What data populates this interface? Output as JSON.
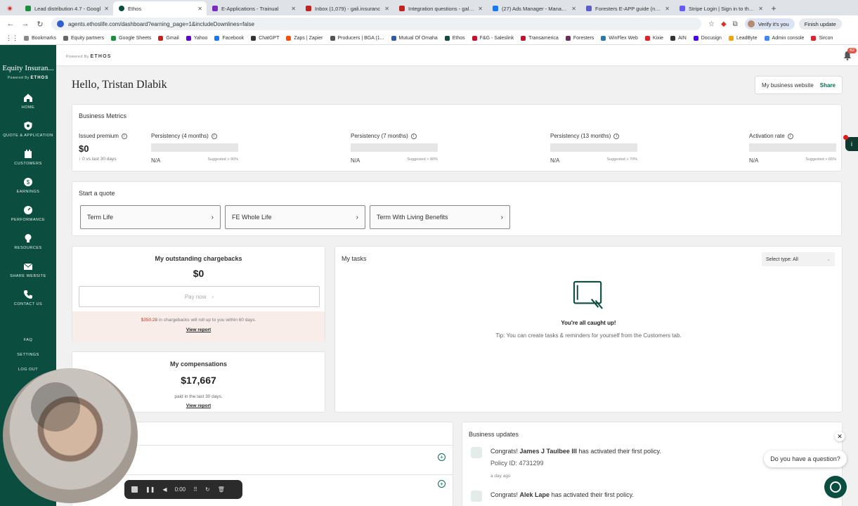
{
  "browser": {
    "tabs": [
      {
        "title": "Lead distribution 4.7 - Googl",
        "color": "#1e8e3e"
      },
      {
        "title": "Ethos",
        "color": "#0b4d3e",
        "active": true
      },
      {
        "title": "E-Applications - Trainual",
        "color": "#7b2cbf"
      },
      {
        "title": "Inbox (1,079) - gali.insuranc",
        "color": "#c5221f"
      },
      {
        "title": "Integration questions - gali@",
        "color": "#c5221f"
      },
      {
        "title": "(27) Ads Manager - Manage a",
        "color": "#1877f2"
      },
      {
        "title": "Foresters E-APP guide (non n",
        "color": "#5b5fc7"
      },
      {
        "title": "Stripe Login | Sign in to the S",
        "color": "#635bff"
      }
    ],
    "url": "agents.ethoslife.com/dashboard?earning_page=1&includeDownlines=false",
    "verify_label": "Verify it's you",
    "finish_label": "Finish update",
    "bookmarks": [
      {
        "label": "Bookmarks",
        "color": "#888"
      },
      {
        "label": "Equity partners",
        "color": "#666"
      },
      {
        "label": "Google Sheets",
        "color": "#1e8e3e"
      },
      {
        "label": "Gmail",
        "color": "#c5221f"
      },
      {
        "label": "Yahoo",
        "color": "#6001d2"
      },
      {
        "label": "Facebook",
        "color": "#1877f2"
      },
      {
        "label": "ChatGPT",
        "color": "#333"
      },
      {
        "label": "Zaps | Zapier",
        "color": "#ff4f00"
      },
      {
        "label": "Producers | BGA (1...",
        "color": "#555"
      },
      {
        "label": "Mutual Of Omaha",
        "color": "#2a5caa"
      },
      {
        "label": "Ethos",
        "color": "#0b4d3e"
      },
      {
        "label": "F&G - Saleslink",
        "color": "#c8102e"
      },
      {
        "label": "Transamerica",
        "color": "#c8102e"
      },
      {
        "label": "Foresters",
        "color": "#6b2d5c"
      },
      {
        "label": "WinFlex Web",
        "color": "#2a7ab0"
      },
      {
        "label": "Kixie",
        "color": "#d9232e"
      },
      {
        "label": "AIN",
        "color": "#333"
      },
      {
        "label": "Docusign",
        "color": "#4c00ff"
      },
      {
        "label": "LeadByte",
        "color": "#f0a500"
      },
      {
        "label": "Admin console",
        "color": "#4285f4"
      },
      {
        "label": "Sircon",
        "color": "#d9232e"
      }
    ]
  },
  "header": {
    "powered_by": "Powered By",
    "ethos": "ETHOS",
    "notif_count": "62"
  },
  "sidebar": {
    "brand": "Equity Insuran...",
    "powered_by": "Powered By",
    "ethos": "ETHOS",
    "items": [
      {
        "label": "HOME",
        "icon": "home-icon"
      },
      {
        "label": "QUOTE & APPLICATION",
        "icon": "shield-icon"
      },
      {
        "label": "CUSTOMERS",
        "icon": "customers-icon"
      },
      {
        "label": "EARNINGS",
        "icon": "dollar-icon"
      },
      {
        "label": "PERFORMANCE",
        "icon": "gauge-icon"
      },
      {
        "label": "RESOURCES",
        "icon": "lightbulb-icon"
      },
      {
        "label": "SHARE WEBSITE",
        "icon": "mail-icon"
      },
      {
        "label": "CONTACT US",
        "icon": "phone-icon"
      }
    ],
    "lower": [
      "FAQ",
      "SETTINGS",
      "LOG OUT"
    ]
  },
  "main": {
    "greeting": "Hello, Tristan Dlabik",
    "business_site": {
      "label": "My business website",
      "share": "Share"
    },
    "metrics": {
      "title": "Business Metrics",
      "issued": {
        "label": "Issued premium",
        "value": "$0",
        "sub_arrow": "↑",
        "sub": "0 vs last 30 days"
      },
      "p4": {
        "label": "Persistency (4 months)",
        "na": "N/A",
        "suggested": "Suggested > 90%"
      },
      "p7": {
        "label": "Persistency (7 months)",
        "na": "N/A",
        "suggested": "Suggested > 80%"
      },
      "p13": {
        "label": "Persistency (13 months)",
        "na": "N/A",
        "suggested": "Suggested > 70%"
      },
      "activation": {
        "label": "Activation rate",
        "na": "N/A",
        "suggested": "Suggested > 65%"
      }
    },
    "quote": {
      "title": "Start a quote",
      "buttons": [
        "Term Life",
        "FE Whole Life",
        "Term With Living Benefits"
      ]
    },
    "chargebacks": {
      "title": "My outstanding chargebacks",
      "amount": "$0",
      "pay_now": "Pay now",
      "note_amount": "$350.28",
      "note_text": " in chargebacks will roll up to you within 60 days.",
      "report": "View report"
    },
    "compensations": {
      "title": "My compensations",
      "amount": "$17,667",
      "paid": "paid in the last 30 days.",
      "report": "View report"
    },
    "tasks": {
      "title": "My tasks",
      "select_label": "Select type: All",
      "caught_up": "You're all caught up!",
      "tip": "Tip: You can create tasks & reminders for yourself from the Customers tab."
    },
    "updates": {
      "title": "Business updates",
      "items": [
        {
          "prefix": "Congrats! ",
          "name": "James J Taulbee III",
          "suffix": " has activated their first policy.",
          "policy": "Policy ID: 4731299",
          "ago": "a day ago"
        },
        {
          "prefix": "Congrats! ",
          "name": "Alek Lape",
          "suffix": " has activated their first policy."
        }
      ]
    }
  },
  "chat": {
    "question": "Do you have a question?"
  },
  "recorder": {
    "time": "0:00"
  }
}
